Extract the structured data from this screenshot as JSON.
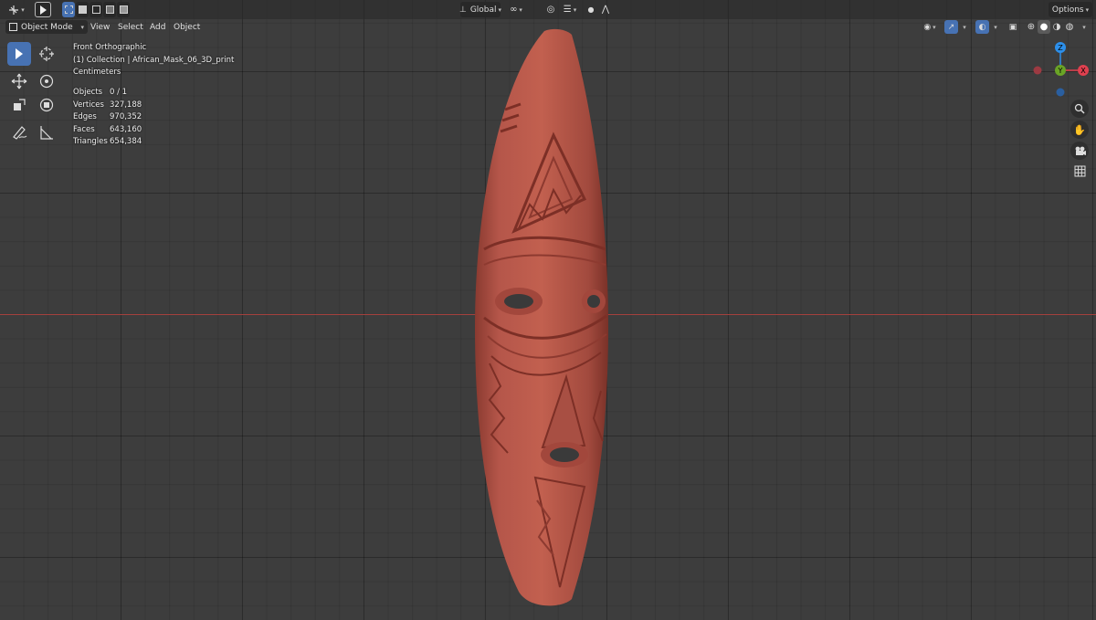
{
  "header": {
    "editor_type_icon": "viewport-icon",
    "transform_orientation": "Global",
    "options_label": "Options"
  },
  "menubar": {
    "mode": "Object Mode",
    "view": "View",
    "select": "Select",
    "add": "Add",
    "object": "Object"
  },
  "overlay": {
    "view_name": "Front Orthographic",
    "collection": "(1) Collection | African_Mask_06_3D_print",
    "units": "Centimeters"
  },
  "stats": [
    {
      "label": "Objects",
      "value": "0 / 1"
    },
    {
      "label": "Vertices",
      "value": "327,188"
    },
    {
      "label": "Edges",
      "value": "970,352"
    },
    {
      "label": "Faces",
      "value": "643,160"
    },
    {
      "label": "Triangles",
      "value": "654,384"
    }
  ],
  "gizmo": {
    "z_label": "Z",
    "y_label": "Y",
    "x_label": "X",
    "x_color": "#e0404f",
    "y_color": "#6aa426",
    "z_color": "#2c8fea"
  },
  "colors": {
    "viewport_bg": "#3d3d3d",
    "accent": "#4772b3",
    "mask": "#b04e42"
  }
}
